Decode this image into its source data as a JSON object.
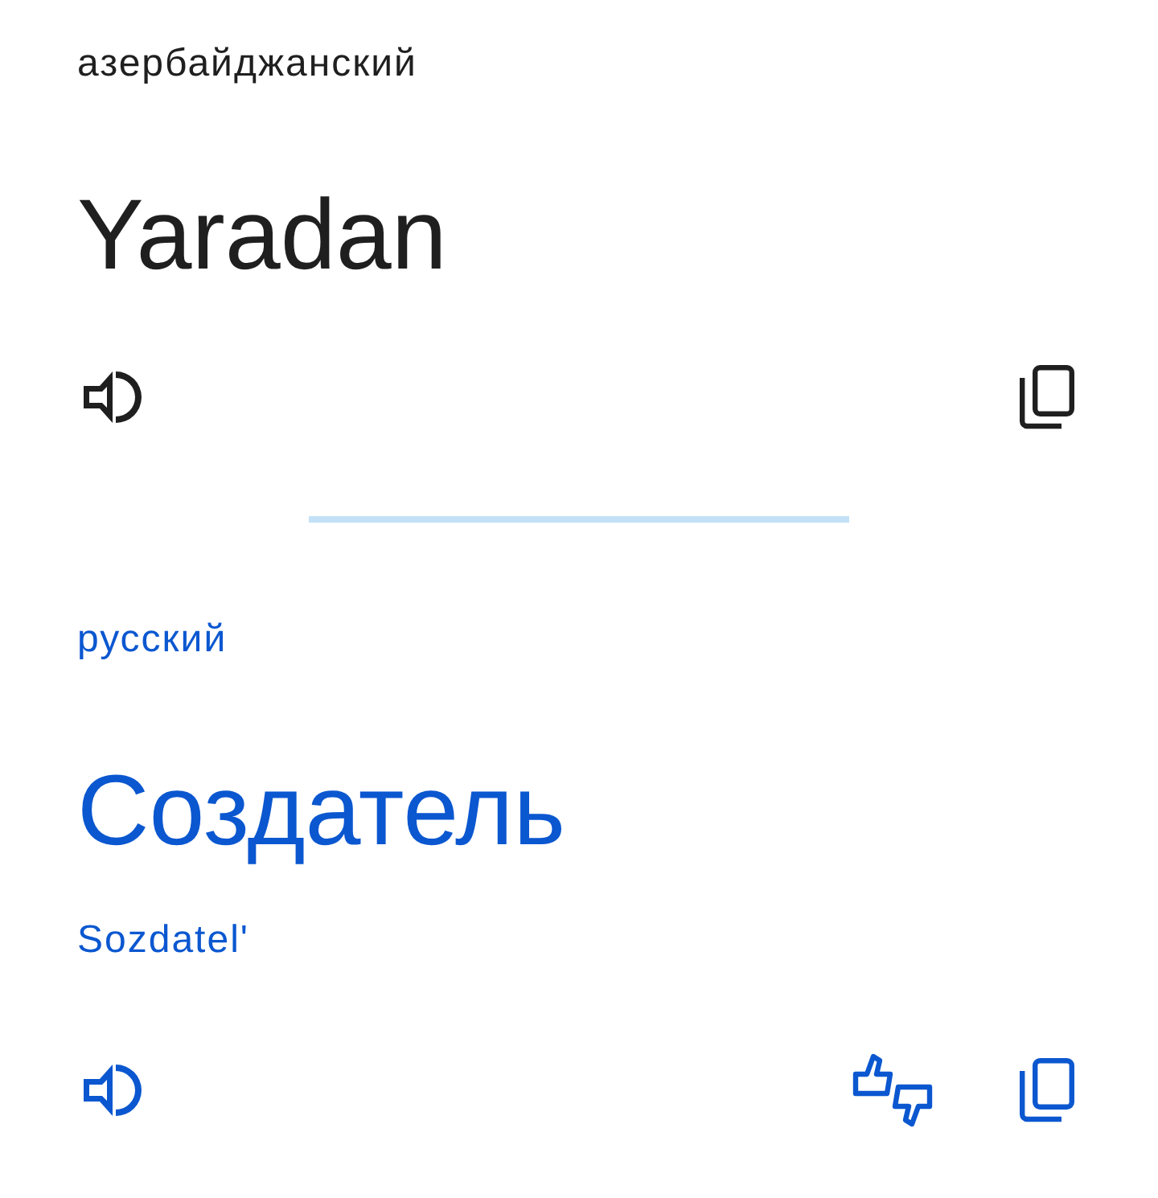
{
  "source": {
    "language": "азербайджанский",
    "text": "Yaradan"
  },
  "target": {
    "language": "русский",
    "text": "Создатель",
    "transliteration": "Sozdatel'"
  }
}
